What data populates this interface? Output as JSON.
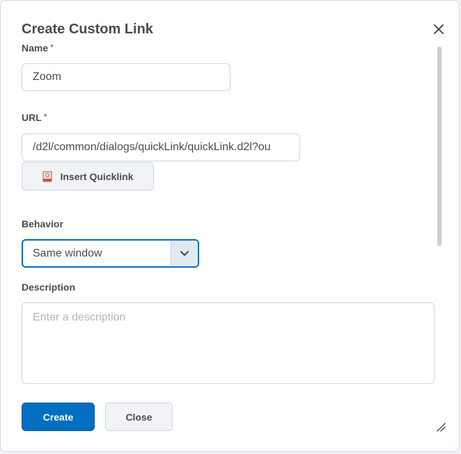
{
  "dialog": {
    "title": "Create Custom Link",
    "close_icon": "close-icon"
  },
  "name_field": {
    "label": "Name",
    "required_mark": "*",
    "value": "Zoom"
  },
  "url_field": {
    "label": "URL",
    "required_mark": "*",
    "value": "/d2l/common/dialogs/quickLink/quickLink.d2l?ou"
  },
  "quicklink_button": {
    "label": "Insert Quicklink",
    "icon": "quicklink-icon"
  },
  "behavior_field": {
    "label": "Behavior",
    "selected": "Same window",
    "icon": "chevron-down-icon"
  },
  "description_field": {
    "label": "Description",
    "placeholder": "Enter a description"
  },
  "footer": {
    "create_label": "Create",
    "close_label": "Close"
  },
  "colors": {
    "primary": "#006fbf",
    "text": "#494c4e",
    "border": "#cdd5dc"
  }
}
